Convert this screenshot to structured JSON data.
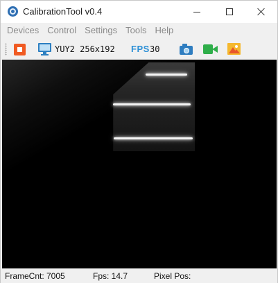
{
  "window": {
    "title": "CalibrationTool v0.4"
  },
  "menu": {
    "items": [
      "Devices",
      "Control",
      "Settings",
      "Tools",
      "Help"
    ]
  },
  "toolbar": {
    "stop_icon": "stop-icon",
    "monitor_icon": "monitor-icon",
    "format_text": "YUY2 256x192",
    "fps_label": "FPS",
    "fps_value": "30",
    "camera_icon": "camera-icon",
    "video_icon": "video-record-icon",
    "gallery_icon": "image-gallery-icon"
  },
  "colors": {
    "stop": "#f05a22",
    "fps_label": "#2b8fd6",
    "camera": "#2e7dc0",
    "video": "#2fae4a",
    "gallery": "#f5b82e",
    "video_background": "#000000"
  },
  "status": {
    "framecnt": "FrameCnt: 7005",
    "fps": "Fps: 14.7",
    "pixel_pos": "Pixel Pos:"
  }
}
